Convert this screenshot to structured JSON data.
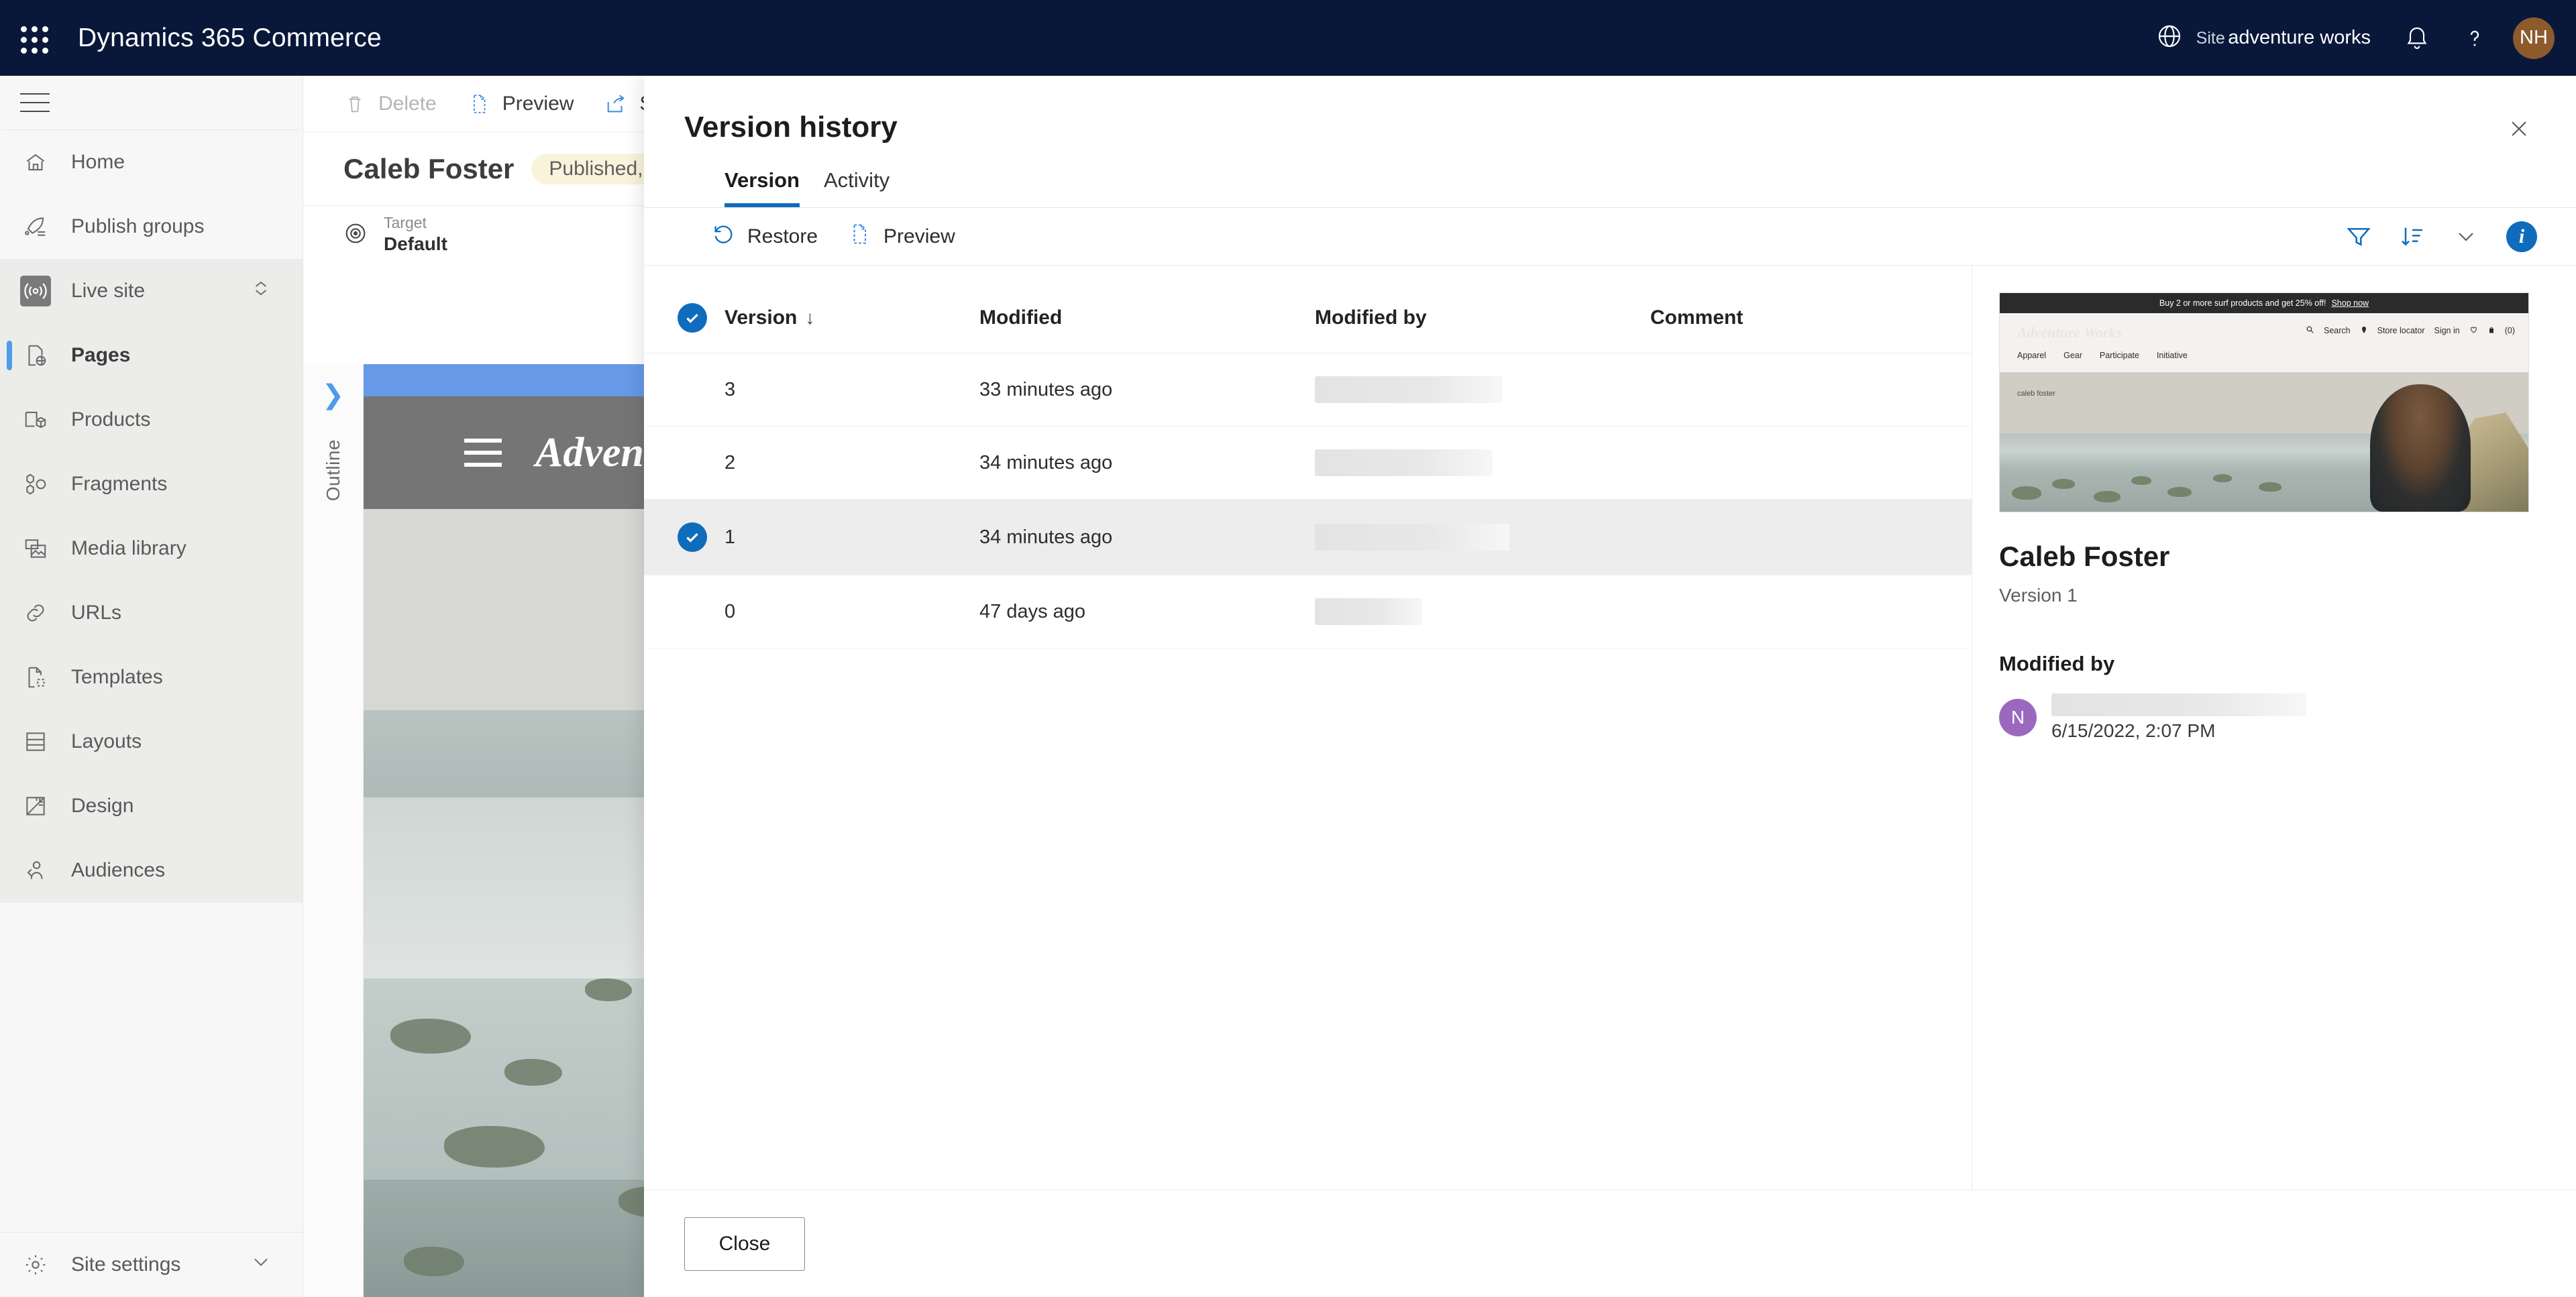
{
  "topbar": {
    "waffle_icon": "app-launcher-icon",
    "brand": "Dynamics 365 Commerce",
    "globe_icon": "globe-icon",
    "site_label": "Site",
    "site_name": "adventure works",
    "notifications_icon": "bell-icon",
    "help_icon": "help-icon",
    "avatar_initials": "NH",
    "avatar_color": "#8c5a2b",
    "background_color": "#09183a"
  },
  "sidebar": {
    "hamburger_icon": "hamburger-menu-icon",
    "items": [
      {
        "label": "Home",
        "icon": "home-icon",
        "selected": false,
        "shaded": false
      },
      {
        "label": "Publish groups",
        "icon": "rocket-list-icon",
        "selected": false,
        "shaded": false
      },
      {
        "label": "Live site",
        "icon": "broadcast-icon",
        "selected": false,
        "shaded": true,
        "chevron": "up-down-chevron-icon"
      },
      {
        "label": "Pages",
        "icon": "page-web-icon",
        "selected": true,
        "shaded": true
      },
      {
        "label": "Products",
        "icon": "product-box-icon",
        "selected": false,
        "shaded": true
      },
      {
        "label": "Fragments",
        "icon": "fragments-icon",
        "selected": false,
        "shaded": true
      },
      {
        "label": "Media library",
        "icon": "media-library-icon",
        "selected": false,
        "shaded": true
      },
      {
        "label": "URLs",
        "icon": "link-icon",
        "selected": false,
        "shaded": true
      },
      {
        "label": "Templates",
        "icon": "template-icon",
        "selected": false,
        "shaded": true
      },
      {
        "label": "Layouts",
        "icon": "layout-icon",
        "selected": false,
        "shaded": true
      },
      {
        "label": "Design",
        "icon": "design-ruler-icon",
        "selected": false,
        "shaded": true
      },
      {
        "label": "Audiences",
        "icon": "people-icon",
        "selected": false,
        "shaded": true
      }
    ],
    "footer": {
      "label": "Site settings",
      "icon": "gear-icon",
      "chevron": "chevron-down-icon"
    }
  },
  "main": {
    "commands": [
      {
        "label": "Delete",
        "icon": "trash-icon",
        "disabled": true
      },
      {
        "label": "Preview",
        "icon": "preview-page-icon",
        "disabled": false
      },
      {
        "label": "S",
        "icon": "share-icon",
        "disabled": false
      }
    ],
    "page_title": "Caleb Foster",
    "status_pill": "Published,",
    "target_label": "Target",
    "target_value": "Default",
    "target_icon": "target-icon",
    "outline_label": "Outline",
    "outline_expand_icon": "chevron-right-icon",
    "canvas_logo": "Adven",
    "canvas_menu_icon": "hamburger-menu-icon"
  },
  "dialog": {
    "title": "Version history",
    "close_icon": "close-icon",
    "tabs": [
      {
        "label": "Version",
        "active": true
      },
      {
        "label": "Activity",
        "active": false
      }
    ],
    "toolbar": {
      "restore_label": "Restore",
      "restore_icon": "restore-undo-icon",
      "preview_label": "Preview",
      "preview_icon": "preview-page-icon",
      "filter_icon": "filter-icon",
      "sort_icon": "sort-descending-icon",
      "sort_chevron_icon": "chevron-down-icon",
      "info_icon": "info-icon",
      "accent_color": "#0f6cbd"
    },
    "table": {
      "select_all_icon": "checkmark-circle-icon",
      "columns": [
        "Version",
        "Modified",
        "Modified by",
        "Comment"
      ],
      "sort_column": "Version",
      "sort_direction_glyph": "↓",
      "rows": [
        {
          "version": "3",
          "modified": "33 minutes ago",
          "modified_by": "",
          "comment": "",
          "selected": false,
          "redact_width": 280
        },
        {
          "version": "2",
          "modified": "34 minutes ago",
          "modified_by": "",
          "comment": "",
          "selected": false,
          "redact_width": 265
        },
        {
          "version": "1",
          "modified": "34 minutes ago",
          "modified_by": "",
          "comment": "",
          "selected": true,
          "redact_width": 290
        },
        {
          "version": "0",
          "modified": "47 days ago",
          "modified_by": "",
          "comment": "",
          "selected": false,
          "redact_width": 160
        }
      ]
    },
    "detail": {
      "thumbnail": {
        "promo_text": "Buy 2 or more surf products and get 25% off!",
        "promo_link": "Shop now",
        "logo": "Adventure Works",
        "utility": [
          "Search",
          "Store locator",
          "Sign in"
        ],
        "search_icon": "search-icon",
        "location_icon": "location-pin-icon",
        "wishlist_icon": "heart-icon",
        "cart_icon": "bag-icon",
        "cart_count": "(0)",
        "menu": [
          "Apparel",
          "Gear",
          "Participate",
          "Initiative"
        ],
        "hero_caption": "caleb foster"
      },
      "title": "Caleb Foster",
      "subtitle": "Version 1",
      "modified_by_heading": "Modified by",
      "avatar_initial": "N",
      "avatar_color": "#9b68c0",
      "modified_date": "6/15/2022, 2:07 PM"
    },
    "footer": {
      "close_label": "Close"
    }
  }
}
